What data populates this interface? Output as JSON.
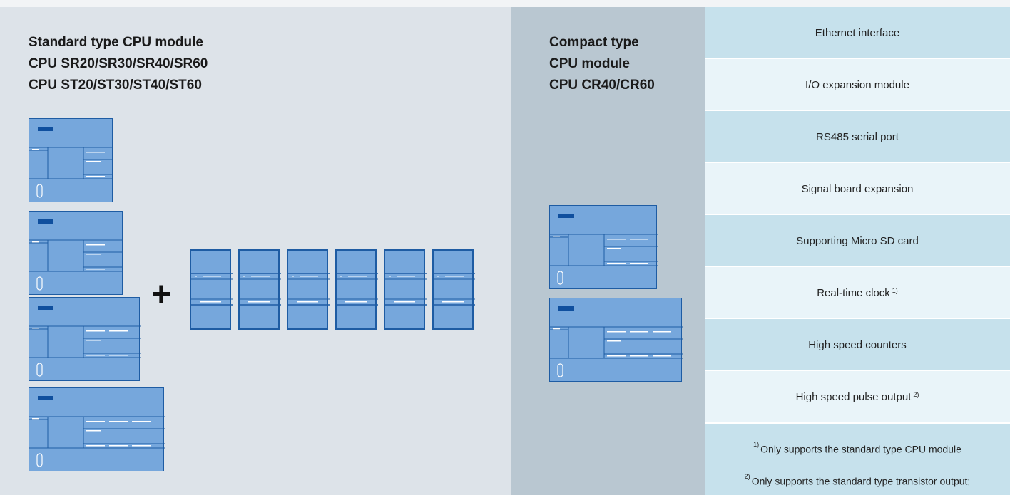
{
  "standard": {
    "title_lines": [
      "Standard type CPU module",
      "CPU SR20/SR30/SR40/SR60",
      "CPU ST20/ST30/ST40/ST60"
    ]
  },
  "plus_sign": "+",
  "compact": {
    "title_lines": [
      "Compact type",
      "CPU module",
      "CPU CR40/CR60"
    ]
  },
  "features": [
    {
      "label": "Ethernet interface",
      "note": ""
    },
    {
      "label": "I/O expansion module",
      "note": ""
    },
    {
      "label": "RS485 serial port",
      "note": ""
    },
    {
      "label": "Signal board expansion",
      "note": ""
    },
    {
      "label": "Supporting Micro SD card",
      "note": ""
    },
    {
      "label": "Real-time clock",
      "note": "1)"
    },
    {
      "label": "High speed counters",
      "note": ""
    },
    {
      "label": "High speed pulse output",
      "note": "2)"
    }
  ],
  "footnotes": [
    {
      "mark": "1)",
      "text": "Only supports the standard type CPU module"
    },
    {
      "mark": "2)",
      "text": "Only supports the standard type transistor output;"
    }
  ],
  "colors": {
    "standard_bg": "#dde3e9",
    "compact_bg": "#b9c7d1",
    "feature_row_alt": "#c6e1ec",
    "feature_row_plain": "#e9f4f9",
    "module_fill": "#76a7dc",
    "module_outline": "#1e5ca3"
  }
}
